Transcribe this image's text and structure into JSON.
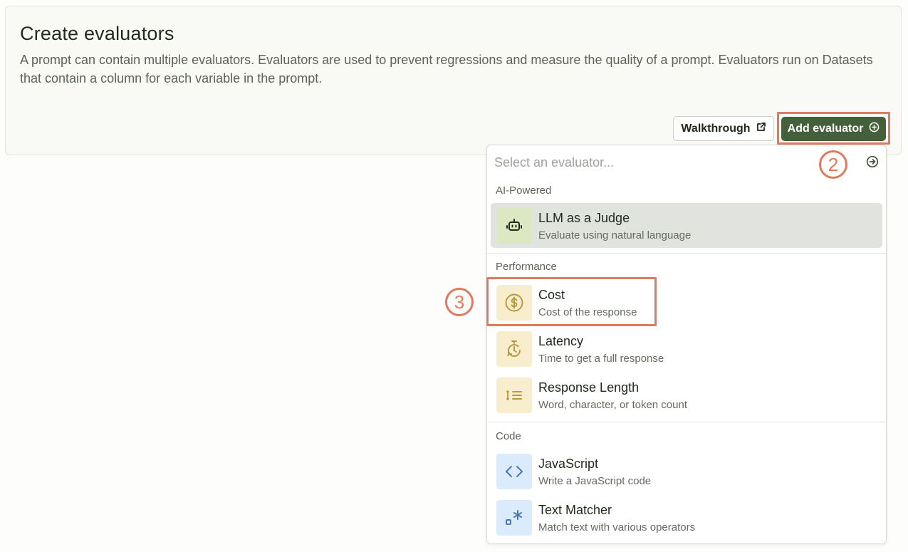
{
  "panel": {
    "title": "Create evaluators",
    "description": "A prompt can contain multiple evaluators. Evaluators are used to prevent regressions and measure the quality of a prompt. Evaluators run on Datasets that contain a column for each variable in the prompt.",
    "walkthrough_label": "Walkthrough",
    "add_evaluator_label": "Add evaluator"
  },
  "annotations": {
    "step_two": "2",
    "step_three": "3",
    "highlight_color": "#df7a5f"
  },
  "menu": {
    "search_placeholder": "Select an evaluator...",
    "search_value": "",
    "sections": [
      {
        "label": "AI-Powered",
        "items": [
          {
            "name": "LLM as a Judge",
            "description": "Evaluate using natural language",
            "icon": "robot-icon",
            "active": true
          }
        ]
      },
      {
        "label": "Performance",
        "items": [
          {
            "name": "Cost",
            "description": "Cost of the response",
            "icon": "dollar-icon"
          },
          {
            "name": "Latency",
            "description": "Time to get a full response",
            "icon": "timer-icon"
          },
          {
            "name": "Response Length",
            "description": "Word, character, or token count",
            "icon": "list-length-icon"
          }
        ]
      },
      {
        "label": "Code",
        "items": [
          {
            "name": "JavaScript",
            "description": "Write a JavaScript code",
            "icon": "code-brackets-icon"
          },
          {
            "name": "Text Matcher",
            "description": "Match text with various operators",
            "icon": "text-match-icon"
          }
        ]
      }
    ]
  },
  "colors": {
    "primary": "#465f3b",
    "ai_icon_bg": "#dde8c2",
    "performance_icon_bg": "#f8edcc",
    "code_icon_bg": "#dcebfb"
  }
}
